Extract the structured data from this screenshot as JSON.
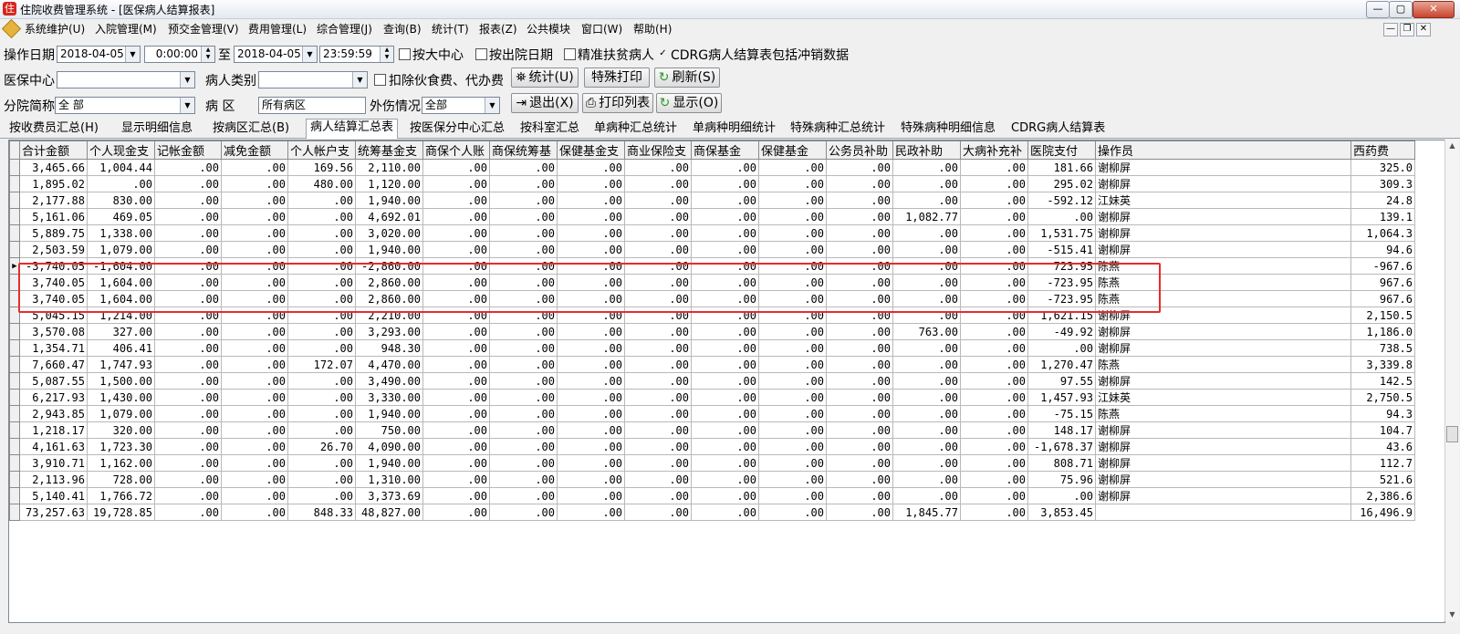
{
  "window": {
    "title": "住院收费管理系统 - [医保病人结算报表]",
    "app_icon_glyph": "住",
    "min_glyph": "—",
    "max_glyph": "▢",
    "close_glyph": "✕"
  },
  "menu": [
    "系统维护(U)",
    "入院管理(M)",
    "预交金管理(V)",
    "费用管理(L)",
    "综合管理(J)",
    "查询(B)",
    "统计(T)",
    "报表(Z)",
    "公共模块",
    "窗口(W)",
    "帮助(H)"
  ],
  "mdi": {
    "min": "—",
    "restore": "❐",
    "close": "✕"
  },
  "filters": {
    "op_date_label": "操作日期",
    "start_date": "2018-04-05",
    "start_time": "0:00:00",
    "to_label": "至",
    "end_date": "2018-04-05",
    "end_time": "23:59:59",
    "by_center_label": "按大中心",
    "by_discharge_label": "按出院日期",
    "poverty_label": "精准扶贫病人",
    "cdrg_label": "CDRG病人结算表包括冲销数据",
    "insurance_center_label": "医保中心",
    "insurance_center_value": "",
    "patient_type_label": "病人类别",
    "patient_type_value": "",
    "deduct_label": "扣除伙食费、代办费",
    "branch_label": "分院简称",
    "branch_value": "全 部",
    "ward_label": "病  区",
    "ward_value": "所有病区",
    "injury_label": "外伤情况",
    "injury_value": "全部",
    "dd_glyph": "▼",
    "spin_up": "▲",
    "spin_down": "▼",
    "check_glyph": "✓"
  },
  "buttons": {
    "stats": "统计(U)",
    "stats_icon": "⛯",
    "special_print": "特殊打印",
    "refresh": "刷新(S)",
    "refresh_icon": "↻",
    "exit": "退出(X)",
    "exit_icon": "⇥",
    "print_list": "打印列表",
    "print_icon": "⎙",
    "show": "显示(O)",
    "show_icon": "↻"
  },
  "tabs": [
    "按收费员汇总(H)",
    "显示明细信息",
    "按病区汇总(B)",
    "病人结算汇总表",
    "按医保分中心汇总",
    "按科室汇总",
    "单病种汇总统计",
    "单病种明细统计",
    "特殊病种汇总统计",
    "特殊病种明细信息",
    "CDRG病人结算表"
  ],
  "table": {
    "columns": [
      "合计金额",
      "个人现金支",
      "记帐金额",
      "减免金额",
      "个人帐户支",
      "统筹基金支",
      "商保个人账",
      "商保统筹基",
      "保健基金支",
      "商业保险支",
      "商保基金",
      "保健基金",
      "公务员补助",
      "民政补助",
      "大病补充补",
      "医院支付",
      "操作员",
      "西药费"
    ],
    "current_marker": "▶",
    "rows": [
      [
        "3,465.66",
        "1,004.44",
        ".00",
        ".00",
        "169.56",
        "2,110.00",
        ".00",
        ".00",
        ".00",
        ".00",
        ".00",
        ".00",
        ".00",
        ".00",
        ".00",
        "181.66",
        "谢柳屏",
        "325.0"
      ],
      [
        "1,895.02",
        ".00",
        ".00",
        ".00",
        "480.00",
        "1,120.00",
        ".00",
        ".00",
        ".00",
        ".00",
        ".00",
        ".00",
        ".00",
        ".00",
        ".00",
        "295.02",
        "谢柳屏",
        "309.3"
      ],
      [
        "2,177.88",
        "830.00",
        ".00",
        ".00",
        ".00",
        "1,940.00",
        ".00",
        ".00",
        ".00",
        ".00",
        ".00",
        ".00",
        ".00",
        ".00",
        ".00",
        "-592.12",
        "江妹英",
        "24.8"
      ],
      [
        "5,161.06",
        "469.05",
        ".00",
        ".00",
        ".00",
        "4,692.01",
        ".00",
        ".00",
        ".00",
        ".00",
        ".00",
        ".00",
        ".00",
        "1,082.77",
        ".00",
        ".00",
        "谢柳屏",
        "139.1"
      ],
      [
        "5,889.75",
        "1,338.00",
        ".00",
        ".00",
        ".00",
        "3,020.00",
        ".00",
        ".00",
        ".00",
        ".00",
        ".00",
        ".00",
        ".00",
        ".00",
        ".00",
        "1,531.75",
        "谢柳屏",
        "1,064.3"
      ],
      [
        "2,503.59",
        "1,079.00",
        ".00",
        ".00",
        ".00",
        "1,940.00",
        ".00",
        ".00",
        ".00",
        ".00",
        ".00",
        ".00",
        ".00",
        ".00",
        ".00",
        "-515.41",
        "谢柳屏",
        "94.6"
      ],
      [
        "-3,740.05",
        "-1,604.00",
        ".00",
        ".00",
        ".00",
        "-2,860.00",
        ".00",
        ".00",
        ".00",
        ".00",
        ".00",
        ".00",
        ".00",
        ".00",
        ".00",
        "723.95",
        "陈燕",
        "-967.6"
      ],
      [
        "3,740.05",
        "1,604.00",
        ".00",
        ".00",
        ".00",
        "2,860.00",
        ".00",
        ".00",
        ".00",
        ".00",
        ".00",
        ".00",
        ".00",
        ".00",
        ".00",
        "-723.95",
        "陈燕",
        "967.6"
      ],
      [
        "3,740.05",
        "1,604.00",
        ".00",
        ".00",
        ".00",
        "2,860.00",
        ".00",
        ".00",
        ".00",
        ".00",
        ".00",
        ".00",
        ".00",
        ".00",
        ".00",
        "-723.95",
        "陈燕",
        "967.6"
      ],
      [
        "5,045.15",
        "1,214.00",
        ".00",
        ".00",
        ".00",
        "2,210.00",
        ".00",
        ".00",
        ".00",
        ".00",
        ".00",
        ".00",
        ".00",
        ".00",
        ".00",
        "1,621.15",
        "谢柳屏",
        "2,150.5"
      ],
      [
        "3,570.08",
        "327.00",
        ".00",
        ".00",
        ".00",
        "3,293.00",
        ".00",
        ".00",
        ".00",
        ".00",
        ".00",
        ".00",
        ".00",
        "763.00",
        ".00",
        "-49.92",
        "谢柳屏",
        "1,186.0"
      ],
      [
        "1,354.71",
        "406.41",
        ".00",
        ".00",
        ".00",
        "948.30",
        ".00",
        ".00",
        ".00",
        ".00",
        ".00",
        ".00",
        ".00",
        ".00",
        ".00",
        ".00",
        "谢柳屏",
        "738.5"
      ],
      [
        "7,660.47",
        "1,747.93",
        ".00",
        ".00",
        "172.07",
        "4,470.00",
        ".00",
        ".00",
        ".00",
        ".00",
        ".00",
        ".00",
        ".00",
        ".00",
        ".00",
        "1,270.47",
        "陈燕",
        "3,339.8"
      ],
      [
        "5,087.55",
        "1,500.00",
        ".00",
        ".00",
        ".00",
        "3,490.00",
        ".00",
        ".00",
        ".00",
        ".00",
        ".00",
        ".00",
        ".00",
        ".00",
        ".00",
        "97.55",
        "谢柳屏",
        "142.5"
      ],
      [
        "6,217.93",
        "1,430.00",
        ".00",
        ".00",
        ".00",
        "3,330.00",
        ".00",
        ".00",
        ".00",
        ".00",
        ".00",
        ".00",
        ".00",
        ".00",
        ".00",
        "1,457.93",
        "江妹英",
        "2,750.5"
      ],
      [
        "2,943.85",
        "1,079.00",
        ".00",
        ".00",
        ".00",
        "1,940.00",
        ".00",
        ".00",
        ".00",
        ".00",
        ".00",
        ".00",
        ".00",
        ".00",
        ".00",
        "-75.15",
        "陈燕",
        "94.3"
      ],
      [
        "1,218.17",
        "320.00",
        ".00",
        ".00",
        ".00",
        "750.00",
        ".00",
        ".00",
        ".00",
        ".00",
        ".00",
        ".00",
        ".00",
        ".00",
        ".00",
        "148.17",
        "谢柳屏",
        "104.7"
      ],
      [
        "4,161.63",
        "1,723.30",
        ".00",
        ".00",
        "26.70",
        "4,090.00",
        ".00",
        ".00",
        ".00",
        ".00",
        ".00",
        ".00",
        ".00",
        ".00",
        ".00",
        "-1,678.37",
        "谢柳屏",
        "43.6"
      ],
      [
        "3,910.71",
        "1,162.00",
        ".00",
        ".00",
        ".00",
        "1,940.00",
        ".00",
        ".00",
        ".00",
        ".00",
        ".00",
        ".00",
        ".00",
        ".00",
        ".00",
        "808.71",
        "谢柳屏",
        "112.7"
      ],
      [
        "2,113.96",
        "728.00",
        ".00",
        ".00",
        ".00",
        "1,310.00",
        ".00",
        ".00",
        ".00",
        ".00",
        ".00",
        ".00",
        ".00",
        ".00",
        ".00",
        "75.96",
        "谢柳屏",
        "521.6"
      ],
      [
        "5,140.41",
        "1,766.72",
        ".00",
        ".00",
        ".00",
        "3,373.69",
        ".00",
        ".00",
        ".00",
        ".00",
        ".00",
        ".00",
        ".00",
        ".00",
        ".00",
        ".00",
        "谢柳屏",
        "2,386.6"
      ],
      [
        "73,257.63",
        "19,728.85",
        ".00",
        ".00",
        "848.33",
        "48,827.00",
        ".00",
        ".00",
        ".00",
        ".00",
        ".00",
        ".00",
        ".00",
        "1,845.77",
        ".00",
        "3,853.45",
        "",
        "16,496.9"
      ]
    ]
  },
  "colors": {
    "highlight": "#e82b2b",
    "app_icon": "#d6261c",
    "close_button": "#c7432e"
  }
}
